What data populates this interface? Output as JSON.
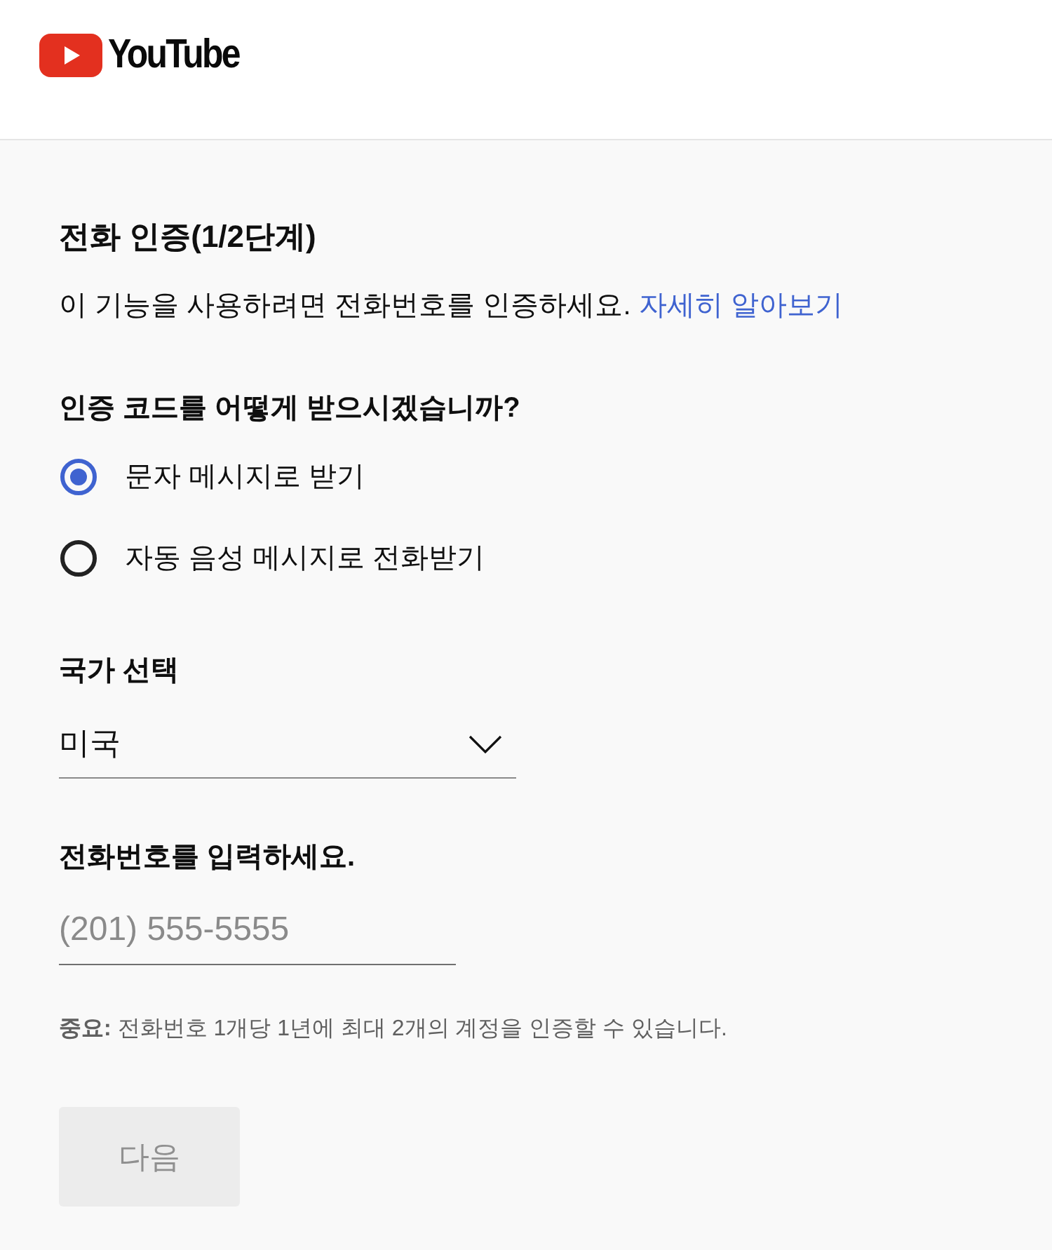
{
  "header": {
    "logo_text": "YouTube"
  },
  "title": "전화 인증(1/2단계)",
  "description": {
    "text": "이 기능을 사용하려면 전화번호를 인증하세요.",
    "link": "자세히 알아보기"
  },
  "delivery": {
    "question": "인증 코드를 어떻게 받으시겠습니까?",
    "options": [
      {
        "label": "문자 메시지로 받기",
        "selected": true
      },
      {
        "label": "자동 음성 메시지로 전화받기",
        "selected": false
      }
    ]
  },
  "country": {
    "label": "국가 선택",
    "value": "미국"
  },
  "phone": {
    "label": "전화번호를 입력하세요.",
    "placeholder": "(201) 555-5555"
  },
  "note": "**중요:** 전화번호 1개당 1년에 최대 2개의 계정을 인증할 수 있습니다.",
  "next_button": {
    "label": "다음",
    "disabled": true
  }
}
